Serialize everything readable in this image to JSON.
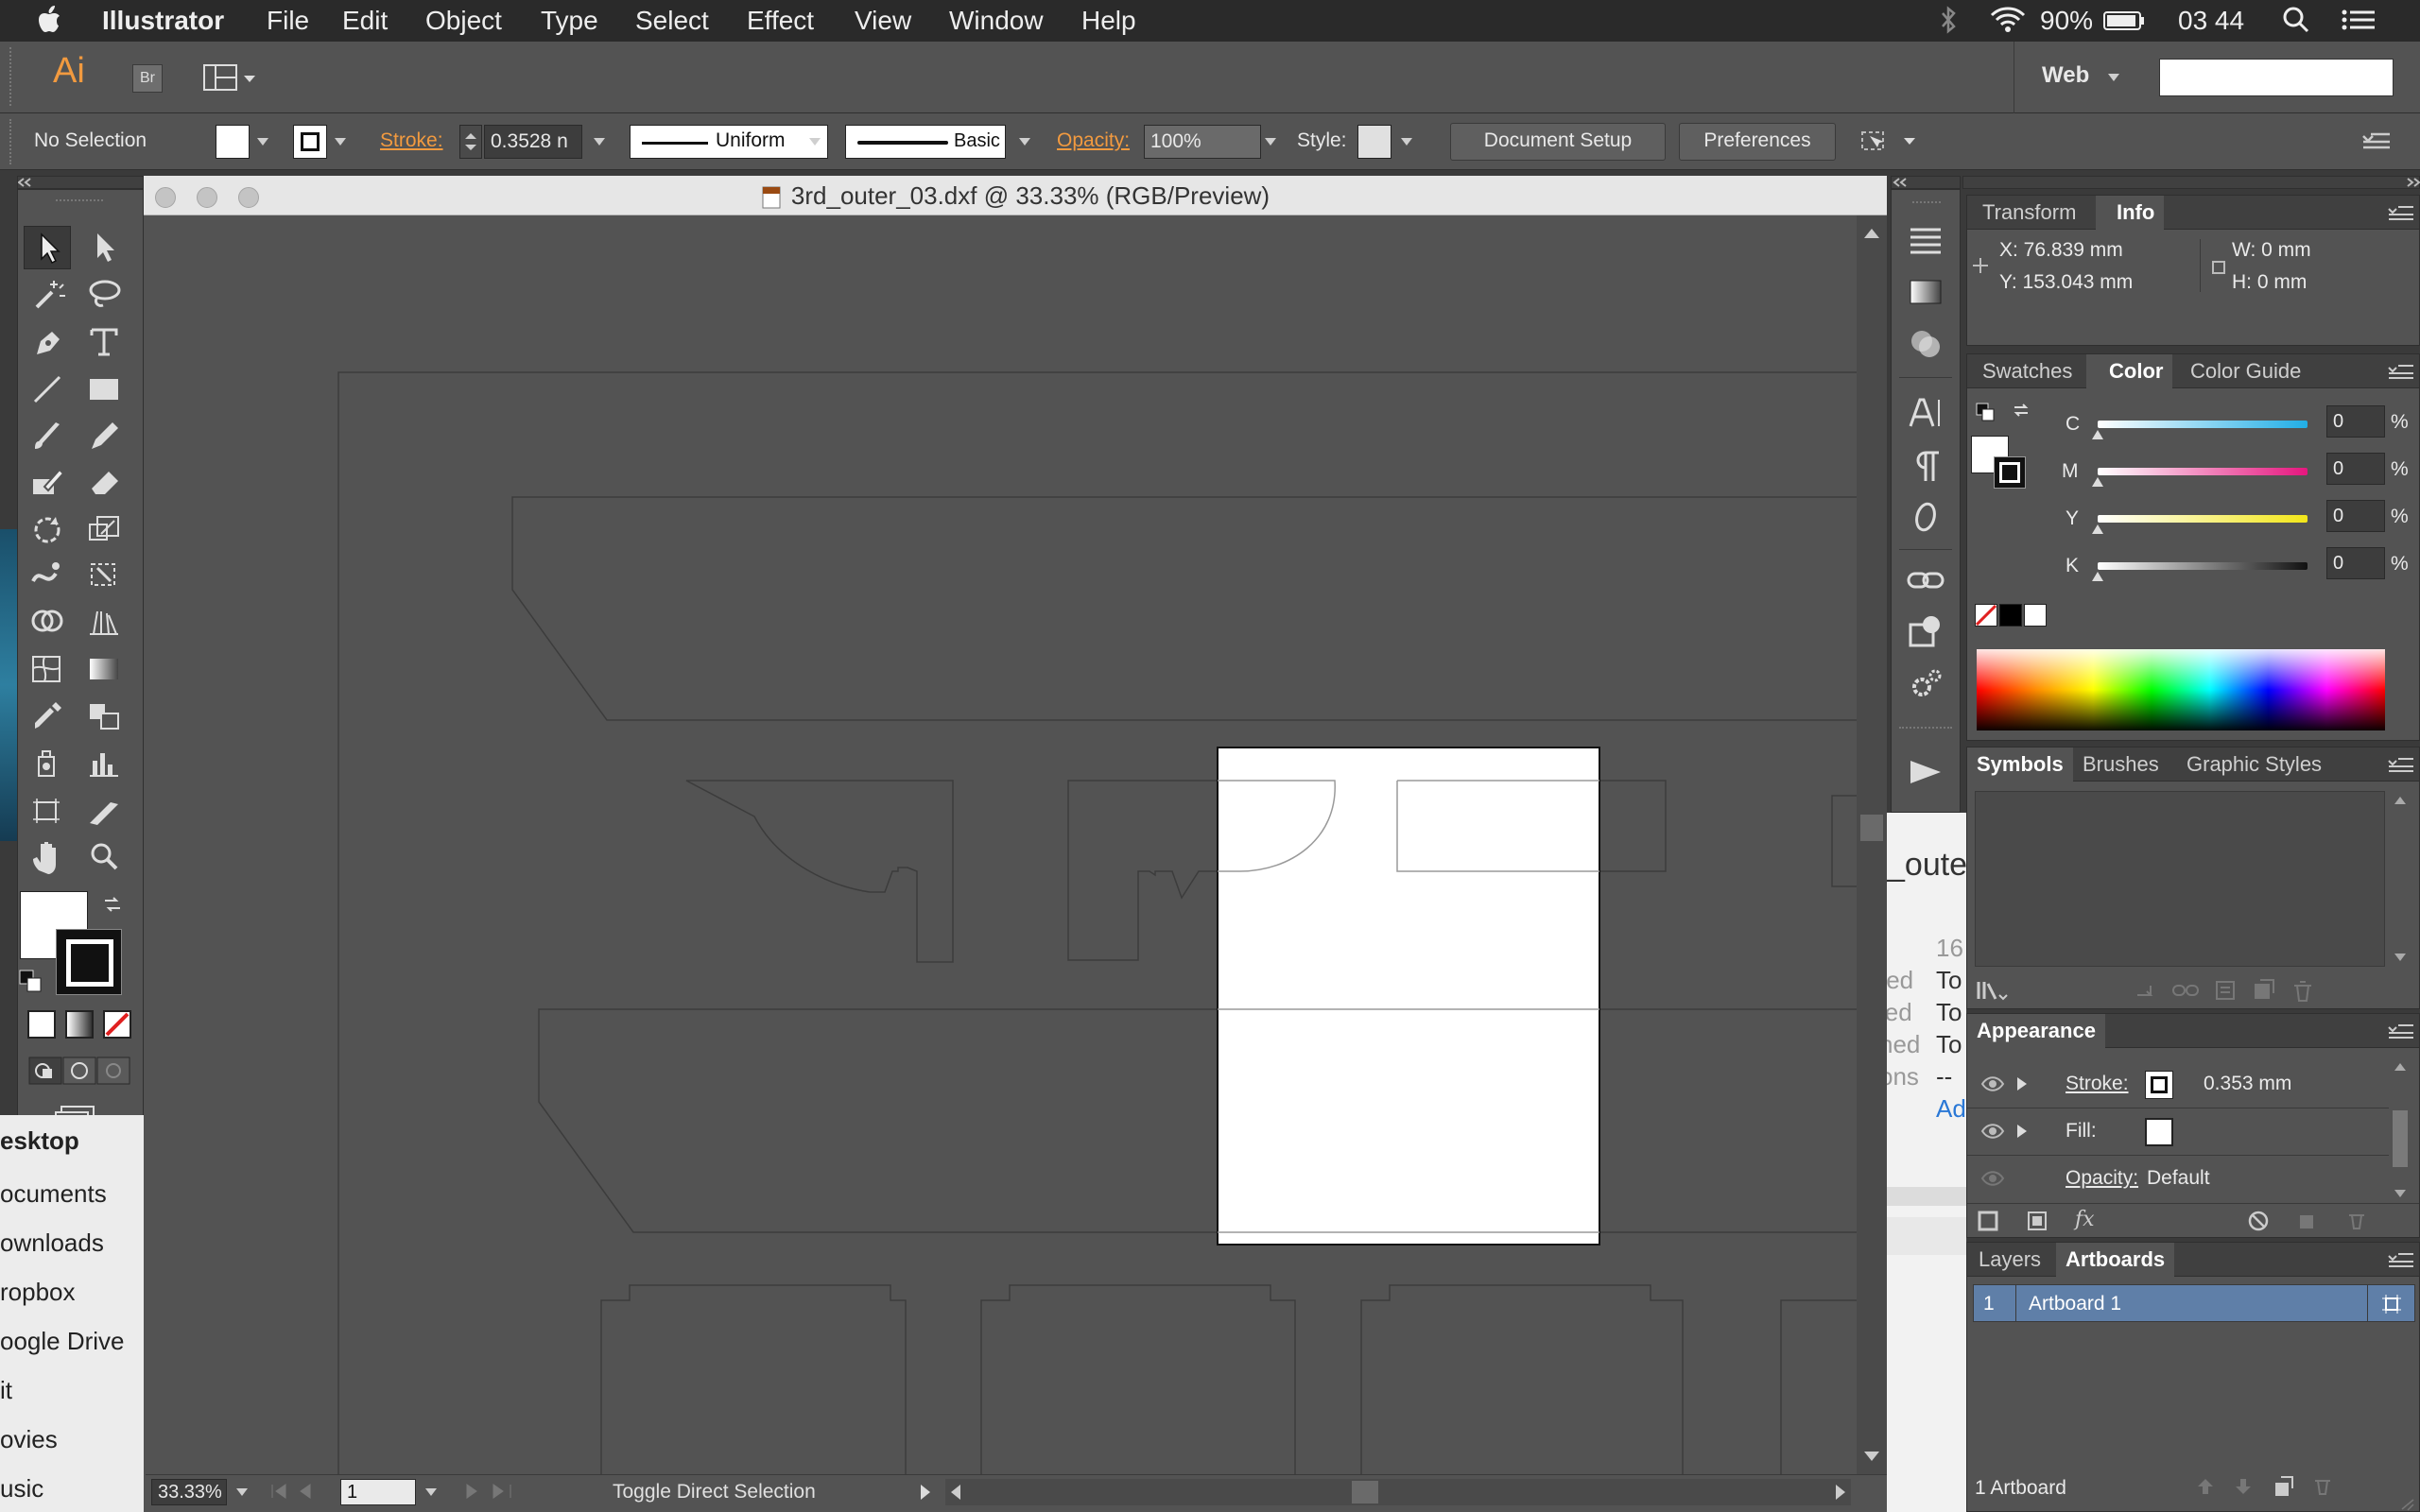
{
  "menubar": {
    "app_name": "Illustrator",
    "menus": [
      "File",
      "Edit",
      "Object",
      "Type",
      "Select",
      "Effect",
      "View",
      "Window",
      "Help"
    ],
    "battery": "90%",
    "clock": "03 44"
  },
  "appbar": {
    "logo": "Ai",
    "bridge": "Br",
    "workspace": "Web"
  },
  "controlbar": {
    "selection": "No Selection",
    "stroke_label": "Stroke:",
    "stroke_value": "0.3528 n",
    "profile": "Uniform",
    "brush": "Basic",
    "opacity_label": "Opacity:",
    "opacity_value": "100%",
    "style_label": "Style:",
    "document_setup": "Document Setup",
    "preferences": "Preferences"
  },
  "document": {
    "title": "3rd_outer_03.dxf @ 33.33% (RGB/Preview)",
    "zoom": "33.33%",
    "artboard_number": "1",
    "status_text": "Toggle Direct Selection"
  },
  "finder_sidebar": {
    "items": [
      "esktop",
      "ocuments",
      "ownloads",
      "ropbox",
      "oogle Drive",
      "it",
      "ovies",
      "usic"
    ]
  },
  "background_finder": {
    "title_fragment": "_oute",
    "lines": [
      "16",
      "To",
      "To",
      "To",
      "--",
      "Ad"
    ],
    "labels": [
      "ted",
      "ied",
      "ned",
      "ons"
    ]
  },
  "transform_panel": {
    "tabs": [
      "Transform",
      "Info"
    ],
    "x": "X: 76.839 mm",
    "y": "Y: 153.043 mm",
    "w": "W: 0 mm",
    "h": "H: 0 mm"
  },
  "color_panel": {
    "tabs": [
      "Swatches",
      "Color",
      "Color Guide"
    ],
    "channels": [
      {
        "label": "C",
        "value": "0",
        "unit": "%"
      },
      {
        "label": "M",
        "value": "0",
        "unit": "%"
      },
      {
        "label": "Y",
        "value": "0",
        "unit": "%"
      },
      {
        "label": "K",
        "value": "0",
        "unit": "%"
      }
    ]
  },
  "symbols_panel": {
    "tabs": [
      "Symbols",
      "Brushes",
      "Graphic Styles"
    ]
  },
  "appearance_panel": {
    "title": "Appearance",
    "stroke_label": "Stroke:",
    "stroke_value": "0.353 mm",
    "fill_label": "Fill:",
    "opacity_label": "Opacity:",
    "opacity_value": "Default"
  },
  "layers_panel": {
    "tabs": [
      "Layers",
      "Artboards"
    ],
    "rows": [
      {
        "num": "1",
        "name": "Artboard 1"
      }
    ],
    "footer": "1 Artboard"
  },
  "colors": {
    "accent_orange": "#f29a3f",
    "panel_bg": "#535353",
    "canvas_bg": "#535353",
    "artboard": "#ffffff"
  }
}
